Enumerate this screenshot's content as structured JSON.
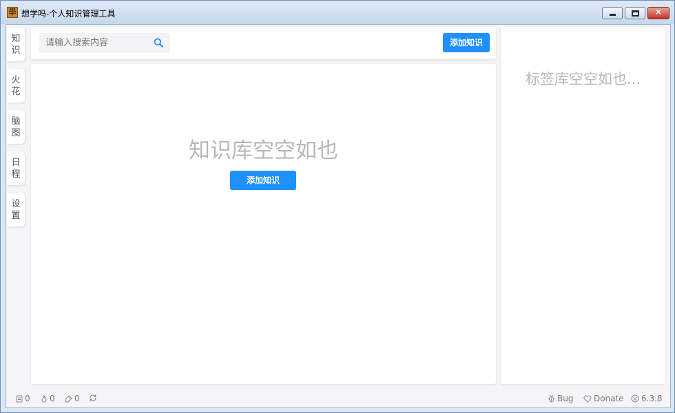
{
  "window": {
    "title": "想学吗-个人知识管理工具",
    "icon_glyph": "學",
    "close_glyph": "✕"
  },
  "sidebar": {
    "tabs": [
      {
        "line1": "知",
        "line2": "识"
      },
      {
        "line1": "火",
        "line2": "花"
      },
      {
        "line1": "脑",
        "line2": "图"
      },
      {
        "line1": "日",
        "line2": "程"
      },
      {
        "line1": "设",
        "line2": "置"
      }
    ]
  },
  "toolbar": {
    "search_placeholder": "请输入搜索内容",
    "search_icon": "search-icon",
    "add_button_label": "添加知识"
  },
  "main": {
    "empty_text": "知识库空空如也",
    "add_button_label": "添加知识"
  },
  "tags": {
    "empty_text": "标签库空空如也..."
  },
  "status": {
    "notes_count": "0",
    "sparks_count": "0",
    "tags_count": "0",
    "bug_label": "Bug",
    "donate_label": "Donate",
    "version": "6.3.8"
  },
  "colors": {
    "accent": "#1e90ff",
    "empty_text": "#b8b8b8",
    "background": "#f5f5f7"
  }
}
